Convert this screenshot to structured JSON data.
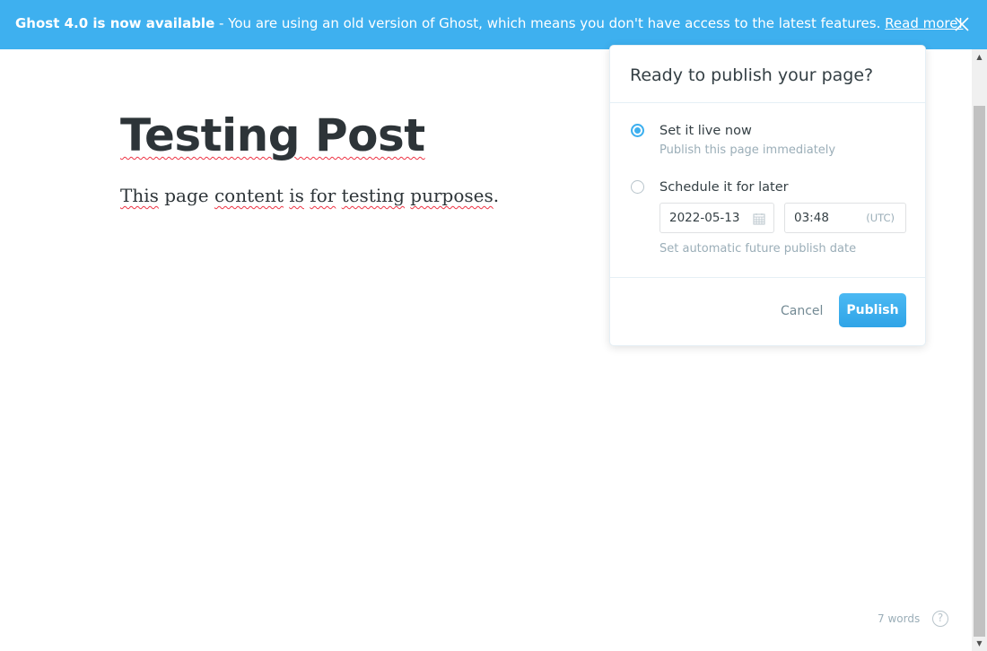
{
  "banner": {
    "headline": "Ghost 4.0 is now available",
    "separator": " - ",
    "message": "You are using an old version of Ghost, which means you don't have access to the latest features. ",
    "link": "Read more!",
    "close_icon": "close-icon"
  },
  "editor": {
    "title": "Testing Post",
    "content_words": [
      "This",
      "page",
      "content",
      "is",
      "for",
      "testing",
      "purposes"
    ],
    "content_end": "."
  },
  "publish_menu": {
    "heading": "Ready to publish your page?",
    "options": [
      {
        "label": "Set it live now",
        "sublabel": "Publish this page immediately",
        "selected": true
      },
      {
        "label": "Schedule it for later",
        "sublabel": "Set automatic future publish date",
        "selected": false
      }
    ],
    "date": "2022-05-13",
    "time": "03:48",
    "timezone": "(UTC)",
    "cancel_label": "Cancel",
    "publish_label": "Publish"
  },
  "footer": {
    "word_count": "7 words",
    "help_label": "?"
  },
  "colors": {
    "accent": "#3eb0ef",
    "text": "#343f44",
    "muted": "#9baeb8"
  }
}
